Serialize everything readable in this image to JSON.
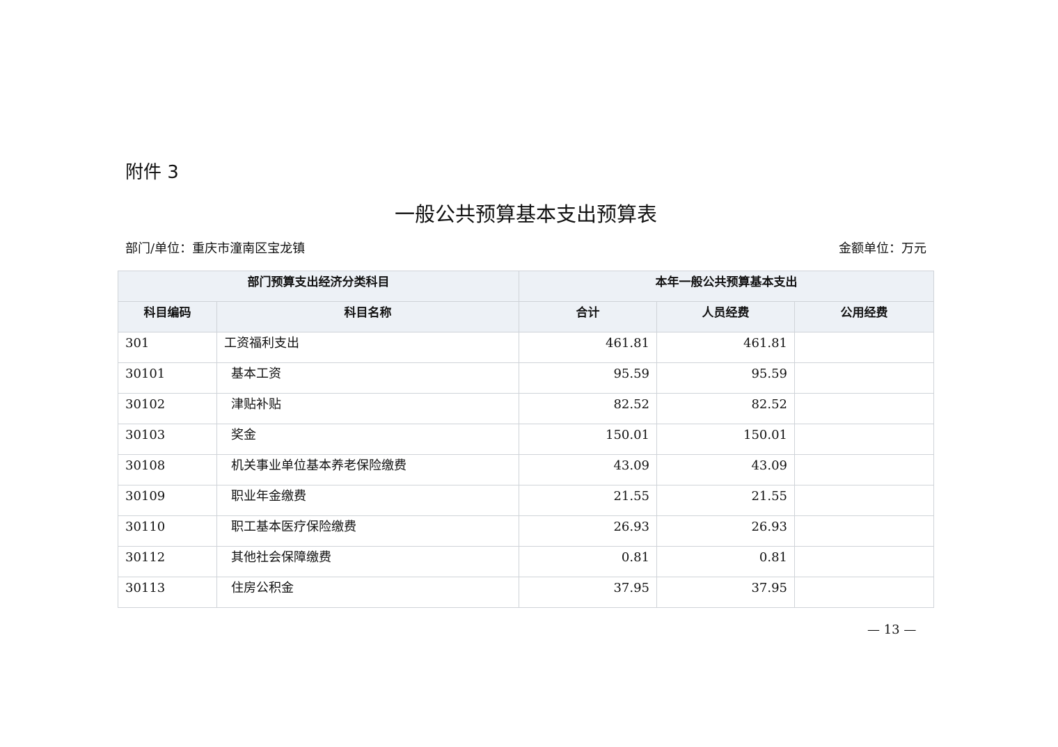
{
  "attachment_label": "附件 3",
  "title": "一般公共预算基本支出预算表",
  "department": "部门/单位：重庆市潼南区宝龙镇",
  "amount_unit": "金额单位：万元",
  "table": {
    "group_headers": {
      "category": "部门预算支出经济分类科目",
      "current_year": "本年一般公共预算基本支出"
    },
    "columns": {
      "code": "科目编码",
      "name": "科目名称",
      "total": "合计",
      "personnel": "人员经费",
      "public": "公用经费"
    },
    "rows": [
      {
        "code": "301",
        "name": "工资福利支出",
        "total": "461.81",
        "personnel": "461.81",
        "public": ""
      },
      {
        "code": "30101",
        "name": "基本工资",
        "total": "95.59",
        "personnel": "95.59",
        "public": ""
      },
      {
        "code": "30102",
        "name": "津贴补贴",
        "total": "82.52",
        "personnel": "82.52",
        "public": ""
      },
      {
        "code": "30103",
        "name": "奖金",
        "total": "150.01",
        "personnel": "150.01",
        "public": ""
      },
      {
        "code": "30108",
        "name": "机关事业单位基本养老保险缴费",
        "total": "43.09",
        "personnel": "43.09",
        "public": ""
      },
      {
        "code": "30109",
        "name": "职业年金缴费",
        "total": "21.55",
        "personnel": "21.55",
        "public": ""
      },
      {
        "code": "30110",
        "name": "职工基本医疗保险缴费",
        "total": "26.93",
        "personnel": "26.93",
        "public": ""
      },
      {
        "code": "30112",
        "name": "其他社会保障缴费",
        "total": "0.81",
        "personnel": "0.81",
        "public": ""
      },
      {
        "code": "30113",
        "name": "住房公积金",
        "total": "37.95",
        "personnel": "37.95",
        "public": ""
      }
    ]
  },
  "page_number": "— 13 —"
}
